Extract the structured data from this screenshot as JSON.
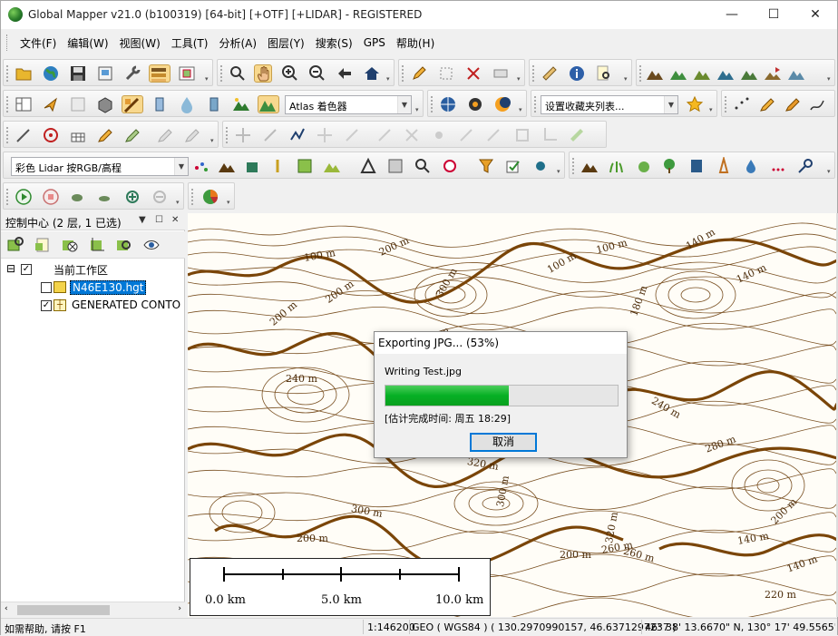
{
  "window": {
    "title": "Global Mapper v21.0 (b100319) [64-bit] [+OTF] [+LIDAR] - REGISTERED",
    "controls": {
      "minimize": "—",
      "maximize": "☐",
      "close": "✕"
    }
  },
  "menu": [
    "文件(F)",
    "编辑(W)",
    "视图(W)",
    "工具(T)",
    "分析(A)",
    "图层(Y)",
    "搜索(S)",
    "GPS",
    "帮助(H)"
  ],
  "toolbars": {
    "atlas_combo": "Atlas 着色器",
    "favorites_combo": "设置收藏夹列表...",
    "lidar_combo": "彩色 Lidar 按RGB/高程"
  },
  "control_center": {
    "title": "控制中心 (2 层, 1 已选)",
    "pin": "▼",
    "restore": "☐",
    "close": "✕",
    "tree": {
      "root_label": "当前工作区",
      "root_expander": "⊟",
      "layers": [
        {
          "label": "N46E130.hgt",
          "checked": false,
          "selected": true
        },
        {
          "label": "GENERATED CONTO",
          "checked": true,
          "selected": false
        }
      ]
    }
  },
  "map": {
    "contour_labels": [
      "100 m",
      "200 m",
      "140 m",
      "100 m",
      "100 m",
      "180 m",
      "200 m",
      "240 m",
      "140 m",
      "200 m",
      "300 m",
      "300 m",
      "140 m",
      "200 m",
      "320 m",
      "240 m",
      "260 m",
      "260 m",
      "200 m",
      "280 m",
      "140 m",
      "220 m",
      "200 m",
      "200 m",
      "300 m",
      "320 m"
    ],
    "scale_labels": [
      "0.0 km",
      "5.0 km",
      "10.0 km"
    ]
  },
  "dialog": {
    "title": "Exporting JPG... (53%)",
    "message": "Writing Test.jpg",
    "progress": 0.53,
    "eta": "[估计完成时间: 周五 18:29]",
    "cancel_label": "取消"
  },
  "status_bar": {
    "help": "如需帮助, 请按 F1",
    "scale": "1:146200",
    "coords": "GEO ( WGS84 ) ( 130.2970990157, 46.6371297237 )",
    "dms": "46° 38' 13.6670\" N, 130° 17' 49.5565\" E"
  },
  "colors": {
    "contour": "#6b3d0a",
    "contour_index": "#7a4508",
    "selection": "#0078d7",
    "progress_fill": "#06b025"
  }
}
